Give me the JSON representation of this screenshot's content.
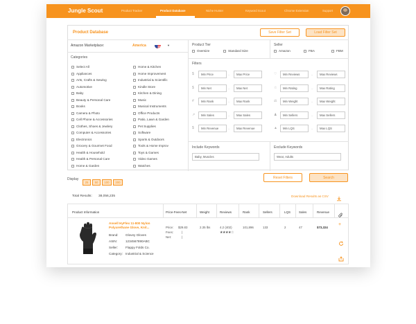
{
  "nav": {
    "logo": "Jungle Scout",
    "links": [
      "Product Tracker",
      "Product Database",
      "Niche Hunter",
      "Keyword Scout",
      "Chrome Extension",
      "Support"
    ],
    "active_index": 1
  },
  "panel": {
    "title": "Product Database",
    "save_filter": "Save Filter Set",
    "load_filter": "Load Filter Set",
    "marketplace_label": "Amazon Marketplace:",
    "marketplace_value": "America"
  },
  "product_tier": {
    "label": "Product Tier",
    "options": [
      "Oversize",
      "Standard Size"
    ]
  },
  "seller": {
    "label": "Seller",
    "options": [
      "Amazon",
      "FBA",
      "FBM"
    ]
  },
  "categories": {
    "label": "Categories",
    "col1": [
      "Select All",
      "Appliances",
      "Arts, Crafts & Sewing",
      "Automotive",
      "Baby",
      "Beauty & Personal Care",
      "Books",
      "Camera & Photo",
      "Cell Phone & Accessories",
      "Clothes, Shoes & Jewlery",
      "Computer & Accessories",
      "Electronics",
      "Grocery & Gourmet Food",
      "Health & Household",
      "Health & Personal Care",
      "Home & Garden"
    ],
    "col2": [
      "Home & Kitchen",
      "Home Improvement",
      "Industrial & Scientific",
      "Kindle Store",
      "Kitchen & Dining",
      "Music",
      "Musical Instruments",
      "Office Products",
      "Patio, Lawn & Garden",
      "Pet Supplies",
      "Software",
      "Sports & Outdoors",
      "Tools & Home Improv",
      "Toys & Games",
      "Video Games",
      "Watches"
    ]
  },
  "filters": {
    "label": "Filters",
    "rows": [
      [
        "Min Price",
        "Max Price",
        "Min Reviews",
        "Max Reviews"
      ],
      [
        "Min Net",
        "Max Net",
        "Min Rating",
        "Max Rating"
      ],
      [
        "Min Rank",
        "Max Rank",
        "Min Weight",
        "Max Weight"
      ],
      [
        "Min Sales",
        "Max Sales",
        "Min Sellers",
        "Max Sellers"
      ],
      [
        "Min Revenue",
        "Max Revenue",
        "Min LQS",
        "Max LQS"
      ]
    ]
  },
  "keywords": {
    "include_label": "Include Keywords",
    "include_placeholder": "Baby, Muscles",
    "exclude_label": "Exclude Keywords",
    "exclude_placeholder": "Wear, Adults"
  },
  "display": {
    "label": "Display",
    "options": [
      "25",
      "50",
      "100",
      "200"
    ]
  },
  "actions": {
    "reset": "Reset Filters",
    "search": "Search"
  },
  "results": {
    "total_label": "Total Results:",
    "total_value": "38,056,235",
    "download": "Download Results as CSV"
  },
  "table": {
    "headers": [
      "Product Information",
      "Price-Fees-Net",
      "Weight",
      "Reviews",
      "Rank",
      "Sellers",
      "LQS",
      "Sales",
      "Revenue"
    ],
    "row": {
      "title": "Ansell HyFlex 11-800 Nylon Polyurethane Glove, Knit...",
      "brand_label": "Brand:",
      "brand": "Glovey Gloves",
      "asin_label": "ASIN:",
      "asin": "1234567890ABC",
      "seller_label": "Seller:",
      "seller": "Flappy Folds Co.",
      "category_label": "Category:",
      "category": "Industrial & Science",
      "price_label": "Price:",
      "price": "$29.83",
      "fees_label": "Fees:",
      "fees": "|",
      "net_label": "Net:",
      "net": "|",
      "weight": "2.35 lbs",
      "reviews": "4.2 (402)",
      "rating": 4.2,
      "rank": "101,896",
      "sellers": "133",
      "lqs": "2",
      "sales": "47",
      "revenue": "$73,324"
    }
  },
  "colors": {
    "accent": "#f7931e",
    "accent_light": "#fde3c4"
  },
  "icons": {
    "marketplace_flag": "us-flag-icon",
    "dropdown": "caret-down-icon",
    "paperclip": "paperclip-icon",
    "download": "download-icon",
    "add": "plus-icon",
    "refresh": "refresh-icon",
    "share": "share-icon"
  }
}
